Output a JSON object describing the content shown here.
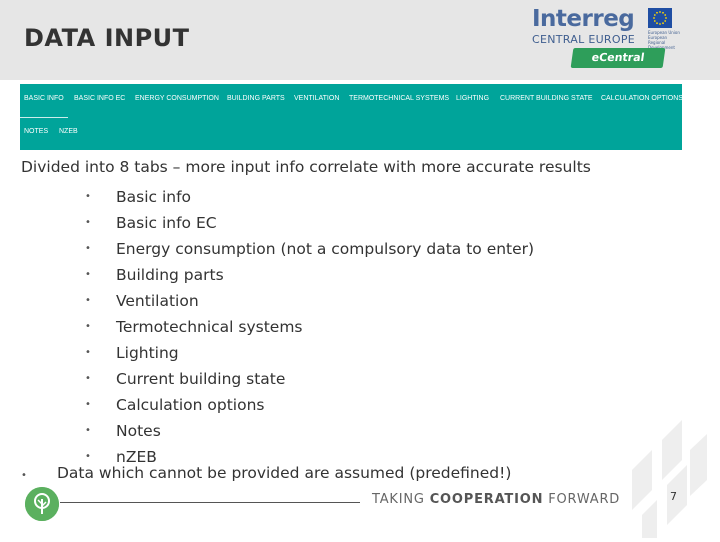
{
  "slide": {
    "title": "DATA INPUT",
    "page_number": "7"
  },
  "logo": {
    "program": "Interreg",
    "region": "CENTRAL EUROPE",
    "project": "eCentral",
    "eu_text": "European Union European Regional Development Fund",
    "brand_color": "#4a6a9e",
    "project_color": "#2e9e5a"
  },
  "nav": {
    "color": "#00a49a",
    "tabs_row1": [
      "BASIC INFO",
      "BASIC INFO EC",
      "ENERGY CONSUMPTION",
      "BUILDING PARTS",
      "VENTILATION",
      "TERMOTECHNICAL SYSTEMS",
      "LIGHTING",
      "CURRENT BUILDING STATE",
      "CALCULATION OPTIONS"
    ],
    "tabs_row2": [
      "NOTES",
      "NZEB"
    ]
  },
  "content": {
    "intro": "Divided into 8 tabs – more input info correlate with more accurate results",
    "items": [
      "Basic info",
      "Basic info EC",
      "Energy consumption (not a compulsory data to enter)",
      "Building parts",
      "Ventilation",
      "Termotechnical systems",
      "Lighting",
      "Current building state",
      "Calculation options",
      "Notes",
      "nZEB"
    ],
    "last_bullet": "Data which cannot be provided are assumed (predefined!)"
  },
  "footer": {
    "tagline_start": "TAKING ",
    "tagline_bold": "COOPERATION",
    "tagline_end": " FORWARD"
  }
}
